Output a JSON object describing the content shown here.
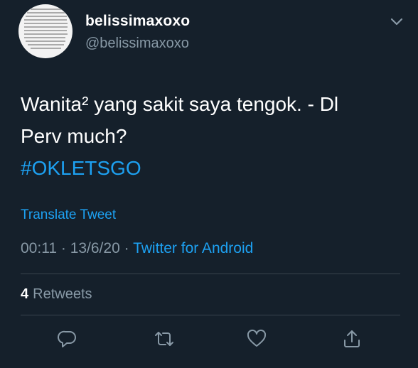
{
  "author": {
    "display_name": "belissimaxoxo",
    "handle": "@belissimaxoxo"
  },
  "tweet": {
    "text_line1": "Wanita² yang sakit saya tengok. - Dl",
    "text_line2": "Perv much?",
    "hashtag": "#OKLETSGO",
    "translate_label": "Translate Tweet",
    "time": "00:11",
    "date": "13/6/20",
    "separator": "·",
    "source": "Twitter for Android"
  },
  "stats": {
    "retweet_count": "4",
    "retweet_label": "Retweets"
  },
  "icons": {
    "caret": "chevron-down-icon",
    "reply": "reply-icon",
    "retweet": "retweet-icon",
    "like": "heart-icon",
    "share": "share-icon"
  },
  "colors": {
    "background": "#15202b",
    "accent": "#1da1f2",
    "secondary_text": "#8899a6",
    "divider": "#38444d"
  }
}
